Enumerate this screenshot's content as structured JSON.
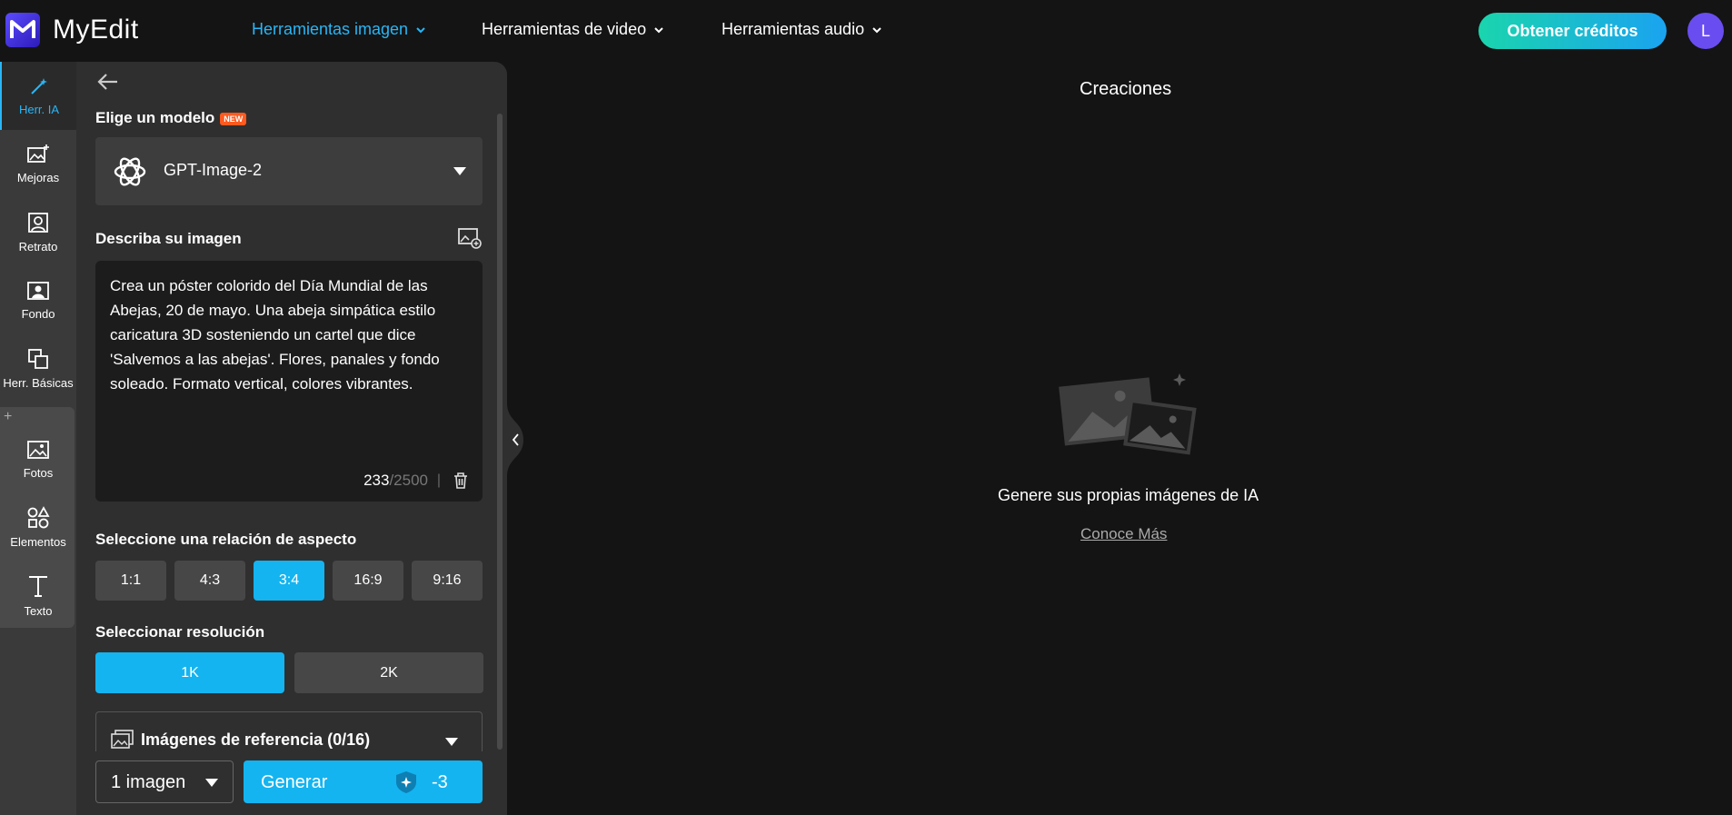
{
  "app": {
    "name": "MyEdit"
  },
  "nav": [
    {
      "label": "Herramientas imagen",
      "active": true
    },
    {
      "label": "Herramientas de video",
      "active": false
    },
    {
      "label": "Herramientas audio",
      "active": false
    }
  ],
  "header": {
    "credits_button": "Obtener créditos",
    "avatar_letter": "L"
  },
  "rail": [
    {
      "label": "Herr. IA",
      "icon": "magic-wand-icon",
      "active": true
    },
    {
      "label": "Mejoras",
      "icon": "image-enhance-icon"
    },
    {
      "label": "Retrato",
      "icon": "portrait-icon"
    },
    {
      "label": "Fondo",
      "icon": "background-icon"
    },
    {
      "label": "Herr. Básicas",
      "icon": "crop-icon"
    },
    {
      "label": "Fotos",
      "icon": "photo-icon"
    },
    {
      "label": "Elementos",
      "icon": "shapes-icon"
    },
    {
      "label": "Texto",
      "icon": "text-icon"
    }
  ],
  "rail_plus": "+",
  "panel": {
    "model_label": "Elige un modelo",
    "new_badge": "NEW",
    "model_value": "GPT-Image-2",
    "describe_label": "Describa su imagen",
    "prompt": "Crea un póster colorido del Día Mundial de las Abejas, 20 de mayo. Una abeja simpática estilo caricatura 3D sosteniendo un cartel que dice 'Salvemos a las abejas'. Flores, panales y fondo soleado. Formato vertical, colores vibrantes.",
    "char_count": "233",
    "char_max": "/2500",
    "separator": "|",
    "aspect_label": "Seleccione una relación de aspecto",
    "aspect_options": [
      "1:1",
      "4:3",
      "3:4",
      "16:9",
      "9:16"
    ],
    "aspect_selected": "3:4",
    "resolution_label": "Seleccionar resolución",
    "resolution_options": [
      "1K",
      "2K"
    ],
    "resolution_selected": "1K",
    "reference_label": "Imágenes de referencia (0/16)",
    "count_value": "1 imagen",
    "generate_label": "Generar",
    "generate_cost": "-3"
  },
  "main": {
    "title": "Creaciones",
    "empty_text": "Genere sus propias imágenes de IA",
    "learn_more": "Conoce Más"
  },
  "colors": {
    "accent": "#14b4f0",
    "nav_active": "#29b6f6",
    "badge": "#ff5a1f"
  }
}
